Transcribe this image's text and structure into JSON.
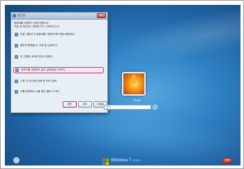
{
  "dialog": {
    "title": "접근성",
    "close_label": "✕",
    "description_line1": "컴퓨터를 사용하기 쉽게 만듭니다",
    "description_line2": "다음 중 해당하는 항목을 모두 선택하십시오",
    "options": [
      {
        "label": "다른 사람이 이 컴퓨터를 사용하도록 허용(내레이터)",
        "icon": "narrator-icon"
      },
      {
        "label": "화면의 항목을 더 크게 표시(돋보기)",
        "icon": "magnifier-icon"
      },
      {
        "label": "더 선명한 색으로 표시(고대비)",
        "icon": "contrast-icon"
      },
      {
        "label": "키보드를 사용하지 않고 입력(화상 키보드)",
        "icon": "keyboard-icon",
        "selected": true
      },
      {
        "label": "고정 키 켜기(한 번에 한 키씩 입력)",
        "icon": "sticky-keys-icon"
      },
      {
        "label": "키를 반복해서 누를 경우 필터 키 켜기",
        "icon": "filter-keys-icon"
      }
    ],
    "buttons": {
      "ok": "확인",
      "cancel": "취소",
      "help": "도움말"
    }
  },
  "login": {
    "username": "User",
    "password_placeholder": "암호"
  },
  "footer": {
    "brand": "Windows 7",
    "edition": "Home"
  },
  "colors": {
    "highlight": "#e0207e",
    "desktop_blue": "#2f82c4"
  }
}
